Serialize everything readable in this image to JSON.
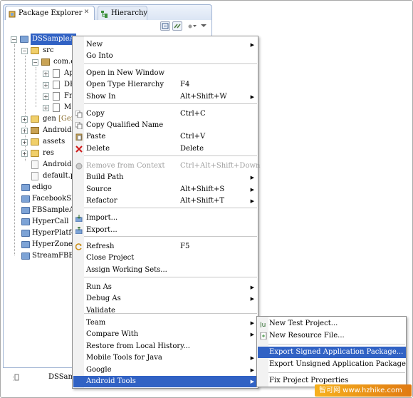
{
  "tabs": {
    "package_explorer": "Package Explorer",
    "hierarchy": "Hierarchy",
    "close_glyph": "✕"
  },
  "tree": {
    "project": "DSSampleA",
    "src": "src",
    "package": "com.c",
    "files": [
      "Ap",
      "DE",
      "Fr",
      "M"
    ],
    "gen": "gen",
    "gen_suffix": "[Gen",
    "android": "Android",
    "assets": "assets",
    "res": "res",
    "manifest": "AndroidM",
    "default_prop": "default.p",
    "projects": [
      "edigo",
      "FacebookSD",
      "FBSampleAp",
      "HyperCall",
      "HyperPlatfor",
      "HyperZone",
      "StreamFBEx"
    ]
  },
  "status": {
    "label": "DSSam"
  },
  "menu": {
    "items": [
      {
        "label": "New",
        "accel": "",
        "submenu": true,
        "disabled": false
      },
      {
        "label": "Go Into",
        "accel": "",
        "submenu": false,
        "disabled": false
      },
      {
        "label": "Open in New Window",
        "accel": "",
        "submenu": false,
        "disabled": false
      },
      {
        "label": "Open Type Hierarchy",
        "accel": "F4",
        "submenu": false,
        "disabled": false
      },
      {
        "label": "Show In",
        "accel": "Alt+Shift+W",
        "submenu": true,
        "disabled": false
      },
      {
        "label": "Copy",
        "accel": "Ctrl+C",
        "submenu": false,
        "disabled": false
      },
      {
        "label": "Copy Qualified Name",
        "accel": "",
        "submenu": false,
        "disabled": false
      },
      {
        "label": "Paste",
        "accel": "Ctrl+V",
        "submenu": false,
        "disabled": false
      },
      {
        "label": "Delete",
        "accel": "Delete",
        "submenu": false,
        "disabled": false
      },
      {
        "label": "Remove from Context",
        "accel": "Ctrl+Alt+Shift+Down",
        "submenu": false,
        "disabled": true
      },
      {
        "label": "Build Path",
        "accel": "",
        "submenu": true,
        "disabled": false
      },
      {
        "label": "Source",
        "accel": "Alt+Shift+S",
        "submenu": true,
        "disabled": false
      },
      {
        "label": "Refactor",
        "accel": "Alt+Shift+T",
        "submenu": true,
        "disabled": false
      },
      {
        "label": "Import...",
        "accel": "",
        "submenu": false,
        "disabled": false
      },
      {
        "label": "Export...",
        "accel": "",
        "submenu": false,
        "disabled": false
      },
      {
        "label": "Refresh",
        "accel": "F5",
        "submenu": false,
        "disabled": false
      },
      {
        "label": "Close Project",
        "accel": "",
        "submenu": false,
        "disabled": false
      },
      {
        "label": "Assign Working Sets...",
        "accel": "",
        "submenu": false,
        "disabled": false
      },
      {
        "label": "Run As",
        "accel": "",
        "submenu": true,
        "disabled": false
      },
      {
        "label": "Debug As",
        "accel": "",
        "submenu": true,
        "disabled": false
      },
      {
        "label": "Validate",
        "accel": "",
        "submenu": false,
        "disabled": false
      },
      {
        "label": "Team",
        "accel": "",
        "submenu": true,
        "disabled": false
      },
      {
        "label": "Compare With",
        "accel": "",
        "submenu": true,
        "disabled": false
      },
      {
        "label": "Restore from Local History...",
        "accel": "",
        "submenu": false,
        "disabled": false
      },
      {
        "label": "Mobile Tools for Java",
        "accel": "",
        "submenu": true,
        "disabled": false
      },
      {
        "label": "Google",
        "accel": "",
        "submenu": true,
        "disabled": false
      },
      {
        "label": "Android Tools",
        "accel": "",
        "submenu": true,
        "disabled": false
      }
    ],
    "highlighted": "Android Tools",
    "arrow_glyph": "▶"
  },
  "submenu": {
    "items": [
      "New Test Project...",
      "New Resource File...",
      "Export Signed Application Package...",
      "Export Unsigned Application Package...",
      "Fix Project Properties"
    ],
    "highlighted": "Export Signed Application Package..."
  },
  "watermark": {
    "text": "智可网 www.hzhike.com"
  },
  "colors": {
    "selection": "#3162c4",
    "menu_border": "#8e8e8e",
    "tab_border": "#9fb3d3"
  }
}
